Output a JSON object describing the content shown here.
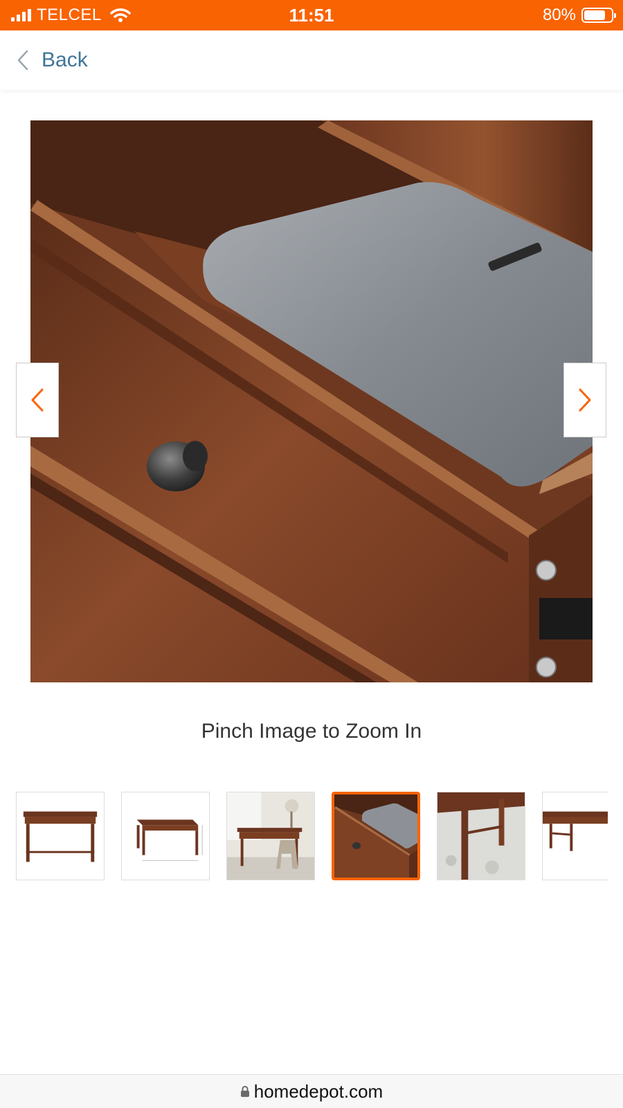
{
  "status_bar": {
    "carrier": "TELCEL",
    "time": "11:51",
    "battery_percent": "80%",
    "battery_level": 0.8,
    "icons": [
      "signal-icon",
      "wifi-icon",
      "battery-icon"
    ]
  },
  "nav": {
    "back_label": "Back",
    "icons": [
      "chevron-left-icon"
    ]
  },
  "gallery": {
    "main_image_description_icon": "desk-drawer-closeup-image",
    "prev_icon": "chevron-left-icon",
    "next_icon": "chevron-right-icon",
    "zoom_hint": "Pinch Image to Zoom In",
    "active_thumbnail_index": 3,
    "thumbnail_count_visible": 6
  },
  "url_bar": {
    "domain": "homedepot.com",
    "icons": [
      "lock-icon"
    ]
  },
  "colors": {
    "accent": "#f96302",
    "link": "#3e7697",
    "wood": "#7a3f24"
  }
}
